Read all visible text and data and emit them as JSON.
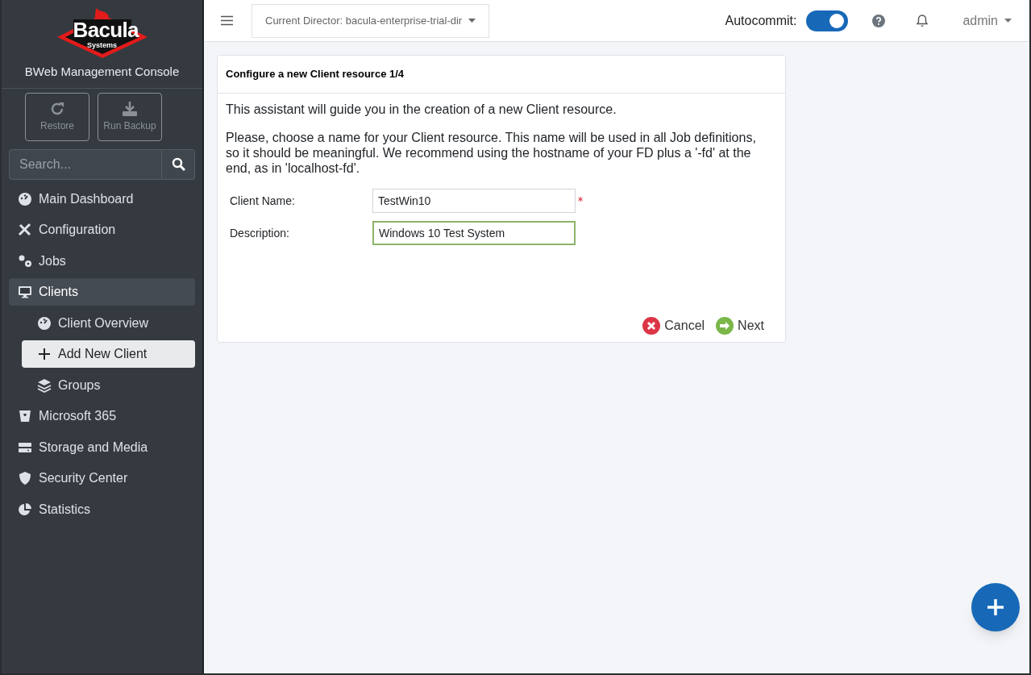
{
  "sidebar": {
    "logo": {
      "word": "Bacula",
      "sub": "Systems"
    },
    "title": "BWeb Management Console",
    "actions": [
      {
        "label": "Restore",
        "disabled": true
      },
      {
        "label": "Run Backup",
        "disabled": true
      }
    ],
    "search": {
      "placeholder": "Search..."
    },
    "items": [
      {
        "label": "Main Dashboard",
        "selected": false
      },
      {
        "label": "Configuration",
        "selected": false
      },
      {
        "label": "Jobs",
        "selected": false
      },
      {
        "label": "Clients",
        "selected": true,
        "expanded": true,
        "children": [
          {
            "label": "Client Overview",
            "selected": false
          },
          {
            "label": "Add New Client",
            "selected": true
          },
          {
            "label": "Groups",
            "selected": false
          }
        ]
      },
      {
        "label": "Microsoft 365",
        "selected": false
      },
      {
        "label": "Storage and Media",
        "selected": false
      },
      {
        "label": "Security Center",
        "selected": false
      },
      {
        "label": "Statistics",
        "selected": false
      }
    ]
  },
  "topbar": {
    "director": "Current Director: bacula-enterprise-trial-dir",
    "autocommit_label": "Autocommit:",
    "autocommit_on": true,
    "user": "admin"
  },
  "wizard": {
    "title": "Configure a new Client resource 1/4",
    "paragraphs": [
      "This assistant will guide you in the creation of a new Client resource.",
      "Please, choose a name for your Client resource. This name will be used in all Job definitions, so it should be meaningful. We recommend using the hostname of your FD plus a '-fd' at the end, as in 'localhost-fd'."
    ],
    "fields": [
      {
        "label": "Client Name:",
        "value": "TestWin10",
        "required": true,
        "focused": false
      },
      {
        "label": "Description:",
        "value": "Windows 10 Test System",
        "required": false,
        "focused": true
      }
    ],
    "buttons": [
      {
        "label": "Cancel",
        "kind": "cancel"
      },
      {
        "label": "Next",
        "kind": "next"
      }
    ]
  }
}
